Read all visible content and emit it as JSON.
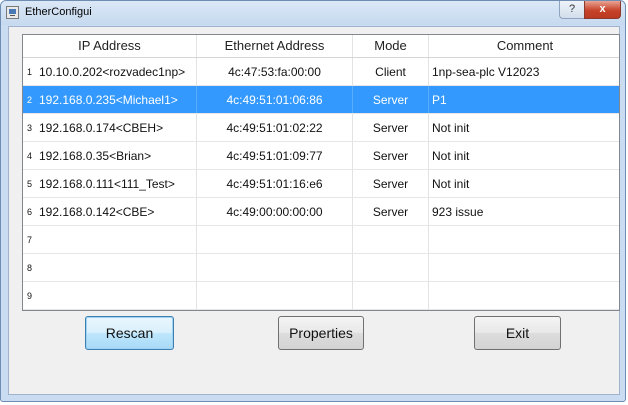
{
  "window": {
    "title": "EtherConfigui",
    "help_glyph": "?",
    "close_glyph": "x"
  },
  "list": {
    "columns": [
      "IP Address",
      "Ethernet Address",
      "Mode",
      "Comment"
    ],
    "rows": [
      {
        "num": "1",
        "ip": "10.10.0.202<rozvadec1np>",
        "eth": "4c:47:53:fa:00:00",
        "mode": "Client",
        "comment": "1np-sea-plc V12023"
      },
      {
        "num": "2",
        "ip": "192.168.0.235<Michael1>",
        "eth": "4c:49:51:01:06:86",
        "mode": "Server",
        "comment": "P1"
      },
      {
        "num": "3",
        "ip": "192.168.0.174<CBEH>",
        "eth": "4c:49:51:01:02:22",
        "mode": "Server",
        "comment": "Not init"
      },
      {
        "num": "4",
        "ip": "192.168.0.35<Brian>",
        "eth": "4c:49:51:01:09:77",
        "mode": "Server",
        "comment": "Not init"
      },
      {
        "num": "5",
        "ip": "192.168.0.111<111_Test>",
        "eth": "4c:49:51:01:16:e6",
        "mode": "Server",
        "comment": "Not init"
      },
      {
        "num": "6",
        "ip": "192.168.0.142<CBE>",
        "eth": "4c:49:00:00:00:00",
        "mode": "Server",
        "comment": "923 issue"
      },
      {
        "num": "7",
        "ip": "",
        "eth": "",
        "mode": "",
        "comment": ""
      },
      {
        "num": "8",
        "ip": "",
        "eth": "",
        "mode": "",
        "comment": ""
      },
      {
        "num": "9",
        "ip": "",
        "eth": "",
        "mode": "",
        "comment": ""
      }
    ],
    "selected_row": "2"
  },
  "buttons": {
    "rescan": "Rescan",
    "properties": "Properties",
    "exit": "Exit"
  },
  "colors": {
    "selection": "#3399ff",
    "title_bar": "#c9dcf1",
    "close_button": "#c7432a",
    "default_button": "#bee6fd"
  }
}
